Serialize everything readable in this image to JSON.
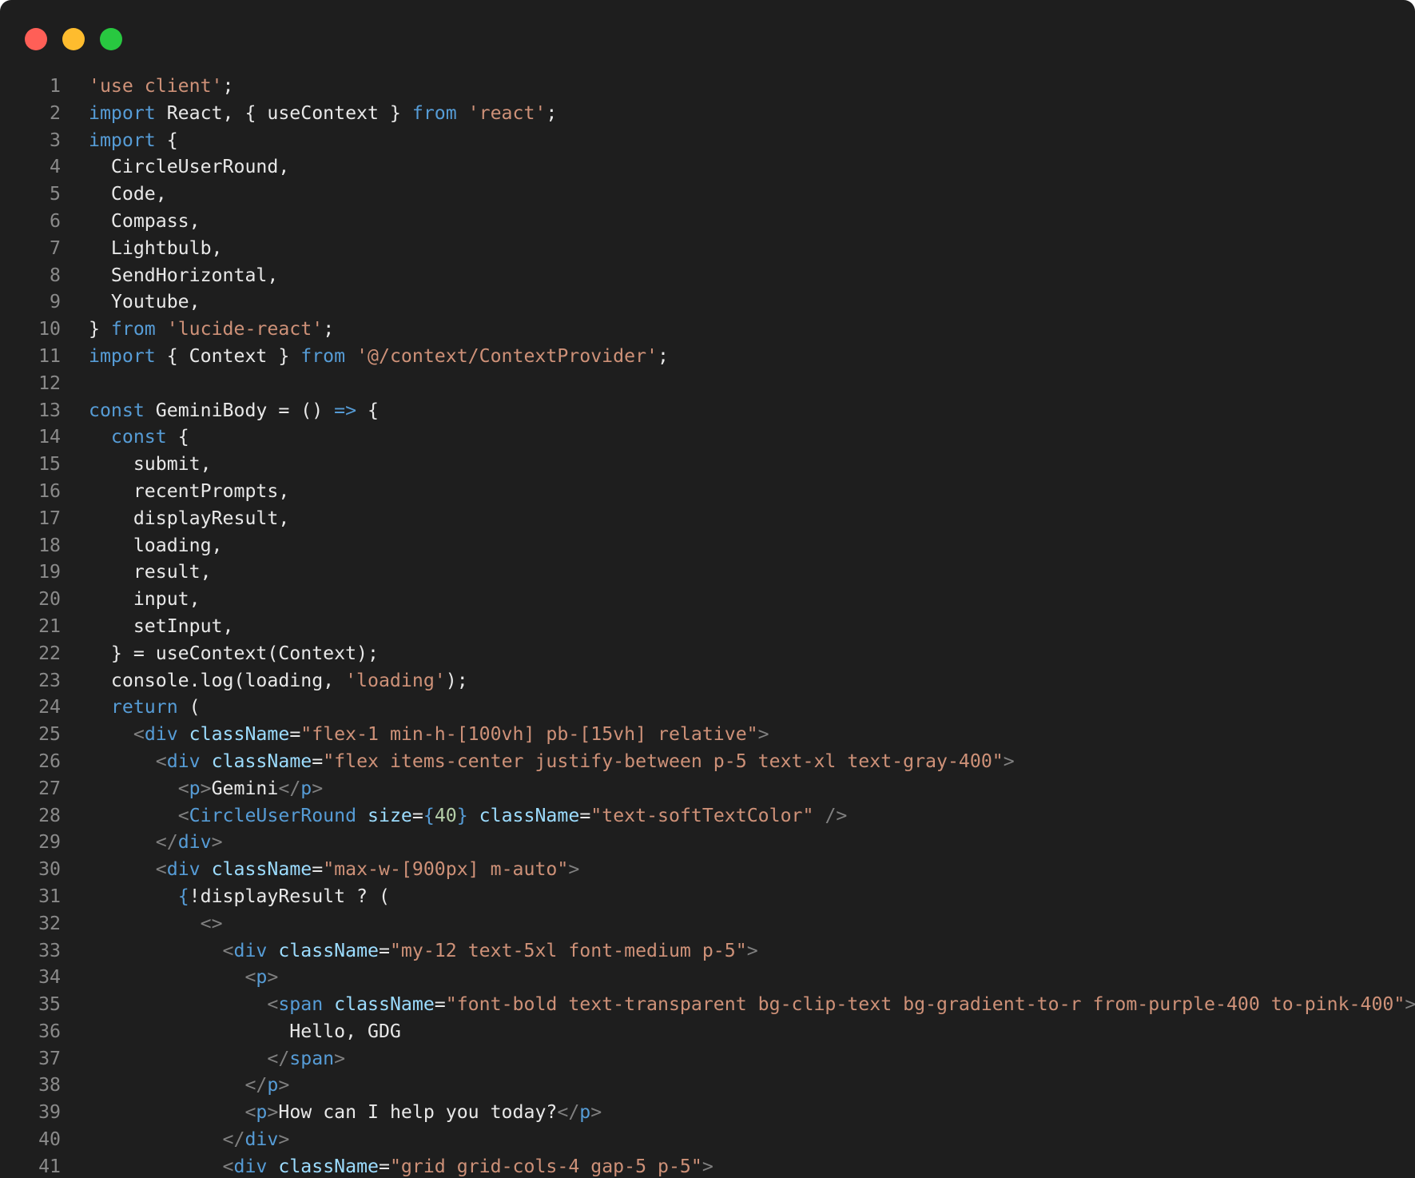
{
  "window": {
    "controls": [
      "close",
      "minimize",
      "zoom"
    ],
    "colors": {
      "background": "#1e1e1e",
      "close": "#ff5f57",
      "minimize": "#febc2e",
      "zoom": "#28c840",
      "keyword": "#569cd6",
      "string": "#ce9178",
      "attribute": "#9cdcfe",
      "number": "#b5cea8",
      "line_number": "#8a8a8a"
    }
  },
  "code": {
    "lines": [
      {
        "n": "1",
        "tokens": [
          {
            "t": "'use client'",
            "c": "str"
          },
          {
            "t": ";",
            "c": "plain"
          }
        ]
      },
      {
        "n": "2",
        "tokens": [
          {
            "t": "import",
            "c": "kw"
          },
          {
            "t": " React, { useContext } ",
            "c": "plain"
          },
          {
            "t": "from",
            "c": "kw"
          },
          {
            "t": " ",
            "c": "plain"
          },
          {
            "t": "'react'",
            "c": "str"
          },
          {
            "t": ";",
            "c": "plain"
          }
        ]
      },
      {
        "n": "3",
        "tokens": [
          {
            "t": "import",
            "c": "kw"
          },
          {
            "t": " {",
            "c": "plain"
          }
        ]
      },
      {
        "n": "4",
        "tokens": [
          {
            "t": "  CircleUserRound,",
            "c": "plain"
          }
        ]
      },
      {
        "n": "5",
        "tokens": [
          {
            "t": "  Code,",
            "c": "plain"
          }
        ]
      },
      {
        "n": "6",
        "tokens": [
          {
            "t": "  Compass,",
            "c": "plain"
          }
        ]
      },
      {
        "n": "7",
        "tokens": [
          {
            "t": "  Lightbulb,",
            "c": "plain"
          }
        ]
      },
      {
        "n": "8",
        "tokens": [
          {
            "t": "  SendHorizontal,",
            "c": "plain"
          }
        ]
      },
      {
        "n": "9",
        "tokens": [
          {
            "t": "  Youtube,",
            "c": "plain"
          }
        ]
      },
      {
        "n": "10",
        "tokens": [
          {
            "t": "} ",
            "c": "plain"
          },
          {
            "t": "from",
            "c": "kw"
          },
          {
            "t": " ",
            "c": "plain"
          },
          {
            "t": "'lucide-react'",
            "c": "str"
          },
          {
            "t": ";",
            "c": "plain"
          }
        ]
      },
      {
        "n": "11",
        "tokens": [
          {
            "t": "import",
            "c": "kw"
          },
          {
            "t": " { Context } ",
            "c": "plain"
          },
          {
            "t": "from",
            "c": "kw"
          },
          {
            "t": " ",
            "c": "plain"
          },
          {
            "t": "'@/context/ContextProvider'",
            "c": "str"
          },
          {
            "t": ";",
            "c": "plain"
          }
        ]
      },
      {
        "n": "12",
        "tokens": []
      },
      {
        "n": "13",
        "tokens": [
          {
            "t": "const",
            "c": "kw"
          },
          {
            "t": " GeminiBody = () ",
            "c": "plain"
          },
          {
            "t": "=>",
            "c": "kw"
          },
          {
            "t": " {",
            "c": "plain"
          }
        ]
      },
      {
        "n": "14",
        "tokens": [
          {
            "t": "  ",
            "c": "plain"
          },
          {
            "t": "const",
            "c": "kw"
          },
          {
            "t": " {",
            "c": "plain"
          }
        ]
      },
      {
        "n": "15",
        "tokens": [
          {
            "t": "    submit,",
            "c": "plain"
          }
        ]
      },
      {
        "n": "16",
        "tokens": [
          {
            "t": "    recentPrompts,",
            "c": "plain"
          }
        ]
      },
      {
        "n": "17",
        "tokens": [
          {
            "t": "    displayResult,",
            "c": "plain"
          }
        ]
      },
      {
        "n": "18",
        "tokens": [
          {
            "t": "    loading,",
            "c": "plain"
          }
        ]
      },
      {
        "n": "19",
        "tokens": [
          {
            "t": "    result,",
            "c": "plain"
          }
        ]
      },
      {
        "n": "20",
        "tokens": [
          {
            "t": "    input,",
            "c": "plain"
          }
        ]
      },
      {
        "n": "21",
        "tokens": [
          {
            "t": "    setInput,",
            "c": "plain"
          }
        ]
      },
      {
        "n": "22",
        "tokens": [
          {
            "t": "  } = useContext(Context);",
            "c": "plain"
          }
        ]
      },
      {
        "n": "23",
        "tokens": [
          {
            "t": "  console.log(loading, ",
            "c": "plain"
          },
          {
            "t": "'loading'",
            "c": "str"
          },
          {
            "t": ");",
            "c": "plain"
          }
        ]
      },
      {
        "n": "24",
        "tokens": [
          {
            "t": "  ",
            "c": "plain"
          },
          {
            "t": "return",
            "c": "kw"
          },
          {
            "t": " (",
            "c": "plain"
          }
        ]
      },
      {
        "n": "25",
        "tokens": [
          {
            "t": "    ",
            "c": "plain"
          },
          {
            "t": "<",
            "c": "tagp"
          },
          {
            "t": "div",
            "c": "tag"
          },
          {
            "t": " ",
            "c": "plain"
          },
          {
            "t": "className",
            "c": "attr"
          },
          {
            "t": "=",
            "c": "plain"
          },
          {
            "t": "\"flex-1 min-h-[100vh] pb-[15vh] relative\"",
            "c": "str"
          },
          {
            "t": ">",
            "c": "tagp"
          }
        ]
      },
      {
        "n": "26",
        "tokens": [
          {
            "t": "      ",
            "c": "plain"
          },
          {
            "t": "<",
            "c": "tagp"
          },
          {
            "t": "div",
            "c": "tag"
          },
          {
            "t": " ",
            "c": "plain"
          },
          {
            "t": "className",
            "c": "attr"
          },
          {
            "t": "=",
            "c": "plain"
          },
          {
            "t": "\"flex items-center justify-between p-5 text-xl text-gray-400\"",
            "c": "str"
          },
          {
            "t": ">",
            "c": "tagp"
          }
        ]
      },
      {
        "n": "27",
        "tokens": [
          {
            "t": "        ",
            "c": "plain"
          },
          {
            "t": "<",
            "c": "tagp"
          },
          {
            "t": "p",
            "c": "tag"
          },
          {
            "t": ">",
            "c": "tagp"
          },
          {
            "t": "Gemini",
            "c": "plain"
          },
          {
            "t": "</",
            "c": "tagp"
          },
          {
            "t": "p",
            "c": "tag"
          },
          {
            "t": ">",
            "c": "tagp"
          }
        ]
      },
      {
        "n": "28",
        "tokens": [
          {
            "t": "        ",
            "c": "plain"
          },
          {
            "t": "<",
            "c": "tagp"
          },
          {
            "t": "CircleUserRound",
            "c": "tag"
          },
          {
            "t": " ",
            "c": "plain"
          },
          {
            "t": "size",
            "c": "attr"
          },
          {
            "t": "=",
            "c": "plain"
          },
          {
            "t": "{",
            "c": "kw"
          },
          {
            "t": "40",
            "c": "num"
          },
          {
            "t": "}",
            "c": "kw"
          },
          {
            "t": " ",
            "c": "plain"
          },
          {
            "t": "className",
            "c": "attr"
          },
          {
            "t": "=",
            "c": "plain"
          },
          {
            "t": "\"text-softTextColor\"",
            "c": "str"
          },
          {
            "t": " />",
            "c": "tagp"
          }
        ]
      },
      {
        "n": "29",
        "tokens": [
          {
            "t": "      ",
            "c": "plain"
          },
          {
            "t": "</",
            "c": "tagp"
          },
          {
            "t": "div",
            "c": "tag"
          },
          {
            "t": ">",
            "c": "tagp"
          }
        ]
      },
      {
        "n": "30",
        "tokens": [
          {
            "t": "      ",
            "c": "plain"
          },
          {
            "t": "<",
            "c": "tagp"
          },
          {
            "t": "div",
            "c": "tag"
          },
          {
            "t": " ",
            "c": "plain"
          },
          {
            "t": "className",
            "c": "attr"
          },
          {
            "t": "=",
            "c": "plain"
          },
          {
            "t": "\"max-w-[900px] m-auto\"",
            "c": "str"
          },
          {
            "t": ">",
            "c": "tagp"
          }
        ]
      },
      {
        "n": "31",
        "tokens": [
          {
            "t": "        ",
            "c": "plain"
          },
          {
            "t": "{",
            "c": "kw"
          },
          {
            "t": "!displayResult ? (",
            "c": "plain"
          }
        ]
      },
      {
        "n": "32",
        "tokens": [
          {
            "t": "          ",
            "c": "plain"
          },
          {
            "t": "<>",
            "c": "tagp"
          }
        ]
      },
      {
        "n": "33",
        "tokens": [
          {
            "t": "            ",
            "c": "plain"
          },
          {
            "t": "<",
            "c": "tagp"
          },
          {
            "t": "div",
            "c": "tag"
          },
          {
            "t": " ",
            "c": "plain"
          },
          {
            "t": "className",
            "c": "attr"
          },
          {
            "t": "=",
            "c": "plain"
          },
          {
            "t": "\"my-12 text-5xl font-medium p-5\"",
            "c": "str"
          },
          {
            "t": ">",
            "c": "tagp"
          }
        ]
      },
      {
        "n": "34",
        "tokens": [
          {
            "t": "              ",
            "c": "plain"
          },
          {
            "t": "<",
            "c": "tagp"
          },
          {
            "t": "p",
            "c": "tag"
          },
          {
            "t": ">",
            "c": "tagp"
          }
        ]
      },
      {
        "n": "35",
        "tokens": [
          {
            "t": "                ",
            "c": "plain"
          },
          {
            "t": "<",
            "c": "tagp"
          },
          {
            "t": "span",
            "c": "tag"
          },
          {
            "t": " ",
            "c": "plain"
          },
          {
            "t": "className",
            "c": "attr"
          },
          {
            "t": "=",
            "c": "plain"
          },
          {
            "t": "\"font-bold text-transparent bg-clip-text bg-gradient-to-r from-purple-400 to-pink-400\"",
            "c": "str"
          },
          {
            "t": ">",
            "c": "tagp"
          }
        ]
      },
      {
        "n": "36",
        "tokens": [
          {
            "t": "                  Hello, GDG",
            "c": "plain"
          }
        ]
      },
      {
        "n": "37",
        "tokens": [
          {
            "t": "                ",
            "c": "plain"
          },
          {
            "t": "</",
            "c": "tagp"
          },
          {
            "t": "span",
            "c": "tag"
          },
          {
            "t": ">",
            "c": "tagp"
          }
        ]
      },
      {
        "n": "38",
        "tokens": [
          {
            "t": "              ",
            "c": "plain"
          },
          {
            "t": "</",
            "c": "tagp"
          },
          {
            "t": "p",
            "c": "tag"
          },
          {
            "t": ">",
            "c": "tagp"
          }
        ]
      },
      {
        "n": "39",
        "tokens": [
          {
            "t": "              ",
            "c": "plain"
          },
          {
            "t": "<",
            "c": "tagp"
          },
          {
            "t": "p",
            "c": "tag"
          },
          {
            "t": ">",
            "c": "tagp"
          },
          {
            "t": "How can I help you today?",
            "c": "plain"
          },
          {
            "t": "</",
            "c": "tagp"
          },
          {
            "t": "p",
            "c": "tag"
          },
          {
            "t": ">",
            "c": "tagp"
          }
        ]
      },
      {
        "n": "40",
        "tokens": [
          {
            "t": "            ",
            "c": "plain"
          },
          {
            "t": "</",
            "c": "tagp"
          },
          {
            "t": "div",
            "c": "tag"
          },
          {
            "t": ">",
            "c": "tagp"
          }
        ]
      },
      {
        "n": "41",
        "tokens": [
          {
            "t": "            ",
            "c": "plain"
          },
          {
            "t": "<",
            "c": "tagp"
          },
          {
            "t": "div",
            "c": "tag"
          },
          {
            "t": " ",
            "c": "plain"
          },
          {
            "t": "className",
            "c": "attr"
          },
          {
            "t": "=",
            "c": "plain"
          },
          {
            "t": "\"grid grid-cols-4 gap-5 p-5\"",
            "c": "str"
          },
          {
            "t": ">",
            "c": "tagp"
          }
        ]
      }
    ]
  }
}
